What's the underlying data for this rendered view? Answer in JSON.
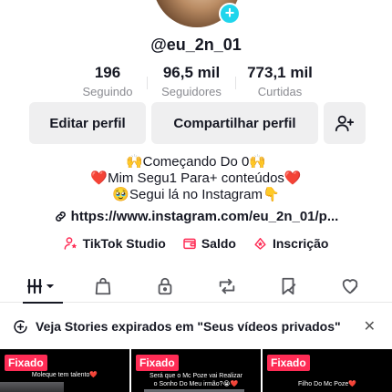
{
  "profile": {
    "username": "@eu_2n_01",
    "stats": [
      {
        "value": "196",
        "label": "Seguindo"
      },
      {
        "value": "96,5 mil",
        "label": "Seguidores"
      },
      {
        "value": "773,1 mil",
        "label": "Curtidas"
      }
    ],
    "avatar_icon": "profile-photo",
    "add_icon": "plus-icon"
  },
  "actions": {
    "edit_label": "Editar perfil",
    "share_label": "Compartilhar perfil",
    "add_friend_icon": "add-user-icon"
  },
  "bio": {
    "lines": [
      "🙌Começando Do 0🙌",
      "❤️Mim Segu1 Para+ conteúdos❤️",
      "🥹Segui lá no Instagram👇"
    ],
    "link": "https://www.instagram.com/eu_2n_01/p..."
  },
  "tools": [
    {
      "label": "TikTok Studio",
      "icon": "studio-icon"
    },
    {
      "label": "Saldo",
      "icon": "wallet-icon"
    },
    {
      "label": "Inscrição",
      "icon": "subscription-icon"
    }
  ],
  "tabs": [
    {
      "icon": "grid-icon",
      "active": true
    },
    {
      "icon": "shopping-bag-icon"
    },
    {
      "icon": "lock-icon"
    },
    {
      "icon": "repost-icon"
    },
    {
      "icon": "bookmark-icon"
    },
    {
      "icon": "liked-icon"
    }
  ],
  "banner": {
    "text": "Veja Stories expirados em \"Seus vídeos privados\""
  },
  "videos": [
    {
      "badge": "Fixado",
      "caption": "Moleque tem talento❤️"
    },
    {
      "badge": "Fixado",
      "caption": "Será que o Mc Poze vai Realizar\no Sonho Do Meu irmão?😭❤️"
    },
    {
      "badge": "Fixado",
      "caption": "Filho Do Mc Poze❤️"
    }
  ],
  "colors": {
    "accent": "#fe2c55",
    "plus": "#20d5ec",
    "button_bg": "#efeff0",
    "text": "#161823",
    "muted": "#8a8b91"
  }
}
